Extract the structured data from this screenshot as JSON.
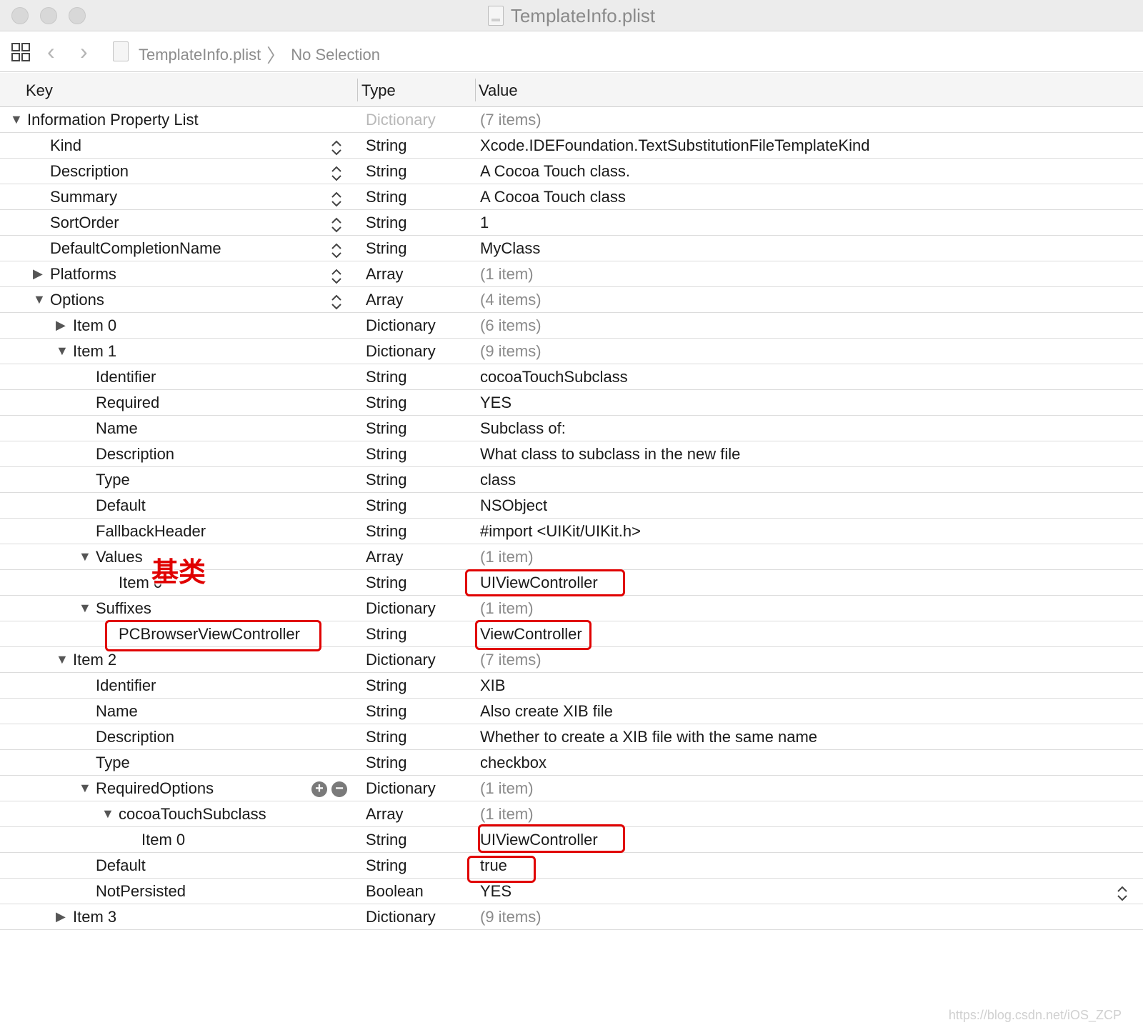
{
  "window": {
    "title": "TemplateInfo.plist"
  },
  "jumpbar": {
    "file": "TemplateInfo.plist",
    "separator": "〉",
    "selection": "No Selection"
  },
  "columns": {
    "key": "Key",
    "type": "Type",
    "value": "Value"
  },
  "rows": [
    {
      "key": "Information Property List",
      "depth": 0,
      "disclosure": "open",
      "type": "Dictionary",
      "value": "(7 items)",
      "type_style": "light",
      "value_style": "muted"
    },
    {
      "key": "Kind",
      "depth": 1,
      "disclosure": "none",
      "type": "String",
      "value": "Xcode.IDEFoundation.TextSubstitutionFileTemplateKind",
      "stepper": true
    },
    {
      "key": "Description",
      "depth": 1,
      "disclosure": "none",
      "type": "String",
      "value": "A Cocoa Touch class.",
      "stepper": true
    },
    {
      "key": "Summary",
      "depth": 1,
      "disclosure": "none",
      "type": "String",
      "value": "A Cocoa Touch class",
      "stepper": true
    },
    {
      "key": "SortOrder",
      "depth": 1,
      "disclosure": "none",
      "type": "String",
      "value": "1",
      "stepper": true
    },
    {
      "key": "DefaultCompletionName",
      "depth": 1,
      "disclosure": "none",
      "type": "String",
      "value": "MyClass",
      "stepper": true
    },
    {
      "key": "Platforms",
      "depth": 1,
      "disclosure": "closed",
      "type": "Array",
      "value": "(1 item)",
      "value_style": "muted",
      "stepper": true
    },
    {
      "key": "Options",
      "depth": 1,
      "disclosure": "open",
      "type": "Array",
      "value": "(4 items)",
      "value_style": "muted",
      "stepper": true
    },
    {
      "key": "Item 0",
      "depth": 2,
      "disclosure": "closed",
      "type": "Dictionary",
      "value": "(6 items)",
      "value_style": "muted"
    },
    {
      "key": "Item 1",
      "depth": 2,
      "disclosure": "open",
      "type": "Dictionary",
      "value": "(9 items)",
      "value_style": "muted"
    },
    {
      "key": "Identifier",
      "depth": 3,
      "disclosure": "none",
      "type": "String",
      "value": "cocoaTouchSubclass"
    },
    {
      "key": "Required",
      "depth": 3,
      "disclosure": "none",
      "type": "String",
      "value": "YES"
    },
    {
      "key": "Name",
      "depth": 3,
      "disclosure": "none",
      "type": "String",
      "value": "Subclass of:"
    },
    {
      "key": "Description",
      "depth": 3,
      "disclosure": "none",
      "type": "String",
      "value": "What class to subclass in the new file"
    },
    {
      "key": "Type",
      "depth": 3,
      "disclosure": "none",
      "type": "String",
      "value": "class"
    },
    {
      "key": "Default",
      "depth": 3,
      "disclosure": "none",
      "type": "String",
      "value": "NSObject"
    },
    {
      "key": "FallbackHeader",
      "depth": 3,
      "disclosure": "none",
      "type": "String",
      "value": "#import <UIKit/UIKit.h>"
    },
    {
      "key": "Values",
      "depth": 3,
      "disclosure": "open",
      "type": "Array",
      "value": "(1 item)",
      "value_style": "muted"
    },
    {
      "key": "Item 0",
      "depth": 4,
      "disclosure": "none",
      "type": "String",
      "value": "UIViewController"
    },
    {
      "key": "Suffixes",
      "depth": 3,
      "disclosure": "open",
      "type": "Dictionary",
      "value": "(1 item)",
      "value_style": "muted"
    },
    {
      "key": "PCBrowserViewController",
      "depth": 4,
      "disclosure": "none",
      "type": "String",
      "value": "ViewController"
    },
    {
      "key": "Item 2",
      "depth": 2,
      "disclosure": "open",
      "type": "Dictionary",
      "value": "(7 items)",
      "value_style": "muted"
    },
    {
      "key": "Identifier",
      "depth": 3,
      "disclosure": "none",
      "type": "String",
      "value": "XIB"
    },
    {
      "key": "Name",
      "depth": 3,
      "disclosure": "none",
      "type": "String",
      "value": "Also create XIB file"
    },
    {
      "key": "Description",
      "depth": 3,
      "disclosure": "none",
      "type": "String",
      "value": "Whether to create a XIB file with the same name"
    },
    {
      "key": "Type",
      "depth": 3,
      "disclosure": "none",
      "type": "String",
      "value": "checkbox"
    },
    {
      "key": "RequiredOptions",
      "depth": 3,
      "disclosure": "open",
      "type": "Dictionary",
      "value": "(1 item)",
      "value_style": "muted",
      "plusminus": true
    },
    {
      "key": "cocoaTouchSubclass",
      "depth": 4,
      "disclosure": "open",
      "type": "Array",
      "value": "(1 item)",
      "value_style": "muted"
    },
    {
      "key": "Item 0",
      "depth": 5,
      "disclosure": "none",
      "type": "String",
      "value": "UIViewController"
    },
    {
      "key": "Default",
      "depth": 3,
      "disclosure": "none",
      "type": "String",
      "value": "true"
    },
    {
      "key": "NotPersisted",
      "depth": 3,
      "disclosure": "none",
      "type": "Boolean",
      "value": "YES",
      "value_stepper": true
    },
    {
      "key": "Item 3",
      "depth": 2,
      "disclosure": "closed",
      "type": "Dictionary",
      "value": "(9 items)",
      "value_style": "muted"
    }
  ],
  "annotation": {
    "label": "基类",
    "color": "#e00000"
  },
  "watermark": "https://blog.csdn.net/iOS_ZCP"
}
